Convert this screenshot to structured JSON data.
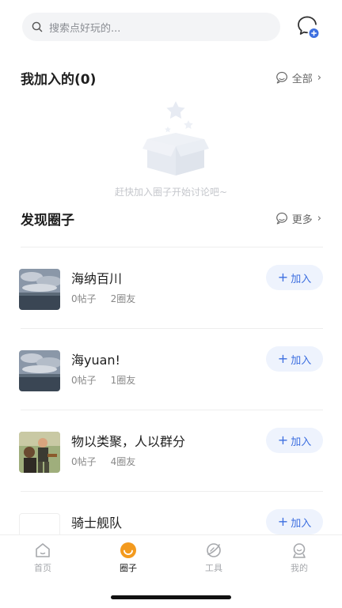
{
  "search": {
    "placeholder": "搜索点好玩的..."
  },
  "joined": {
    "title": "我加入的(0)",
    "link_label": "全部",
    "empty_text": "赶快加入圈子开始讨论吧~"
  },
  "discover": {
    "title": "发现圈子",
    "link_label": "更多"
  },
  "circles": [
    {
      "name": "海纳百川",
      "posts": "0帖子",
      "members": "2圈友",
      "join_label": "加入",
      "avatar": "sea-sky-photo"
    },
    {
      "name": "海yuan!",
      "posts": "0帖子",
      "members": "1圈友",
      "join_label": "加入",
      "avatar": "sea-sky-photo"
    },
    {
      "name": "物以类聚，人以群分",
      "posts": "0帖子",
      "members": "4圈友",
      "join_label": "加入",
      "avatar": "costume-characters-photo"
    },
    {
      "name": "骑士舰队",
      "posts": "",
      "members": "",
      "join_label": "加入",
      "avatar": "blank"
    }
  ],
  "tabs": [
    {
      "label": "首页",
      "icon": "home-icon",
      "active": false
    },
    {
      "label": "圈子",
      "icon": "circle-icon",
      "active": true
    },
    {
      "label": "工具",
      "icon": "tool-icon",
      "active": false
    },
    {
      "label": "我的",
      "icon": "profile-icon",
      "active": false
    }
  ],
  "colors": {
    "accent": "#3d6fe0",
    "join_bg": "#eef3fd",
    "active_tab": "#f39a1e"
  }
}
